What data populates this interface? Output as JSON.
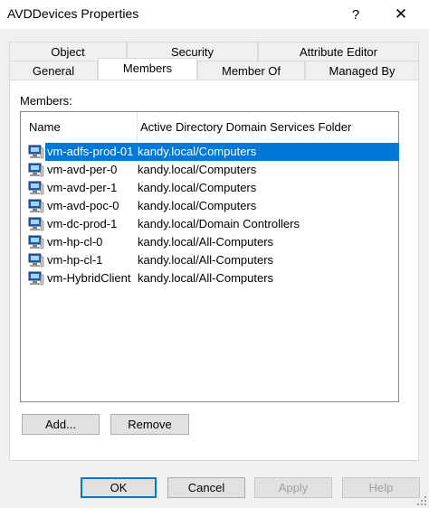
{
  "window": {
    "title": "AVDDevices Properties",
    "help_glyph": "?",
    "close_glyph": "✕"
  },
  "tabs": {
    "row1": [
      "Object",
      "Security",
      "Attribute Editor"
    ],
    "row2": [
      "General",
      "Members",
      "Member Of",
      "Managed By"
    ],
    "active": "Members"
  },
  "members": {
    "label": "Members:",
    "columns": [
      "Name",
      "Active Directory Domain Services Folder"
    ],
    "rows": [
      {
        "name": "vm-adfs-prod-01",
        "folder": "kandy.local/Computers",
        "selected": true
      },
      {
        "name": "vm-avd-per-0",
        "folder": "kandy.local/Computers"
      },
      {
        "name": "vm-avd-per-1",
        "folder": "kandy.local/Computers"
      },
      {
        "name": "vm-avd-poc-0",
        "folder": "kandy.local/Computers"
      },
      {
        "name": "vm-dc-prod-1",
        "folder": "kandy.local/Domain Controllers"
      },
      {
        "name": "vm-hp-cl-0",
        "folder": "kandy.local/All-Computers"
      },
      {
        "name": "vm-hp-cl-1",
        "folder": "kandy.local/All-Computers"
      },
      {
        "name": "vm-HybridClient",
        "folder": "kandy.local/All-Computers"
      }
    ],
    "add_label": "Add...",
    "remove_label": "Remove"
  },
  "footer": {
    "ok": "OK",
    "cancel": "Cancel",
    "apply": "Apply",
    "help": "Help"
  },
  "colors": {
    "selection": "#0078d7",
    "window_bg": "#f0f0f0"
  },
  "icons": {
    "row_icon": "computer-icon"
  }
}
